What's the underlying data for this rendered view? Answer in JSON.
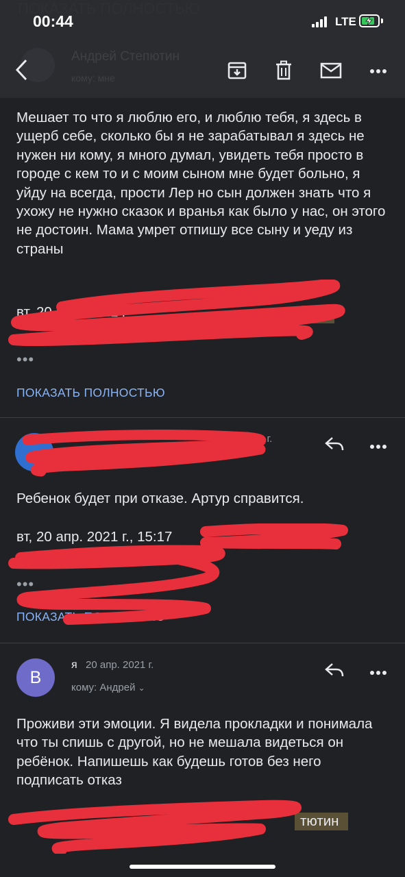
{
  "status_bar": {
    "time": "00:44",
    "network": "LTE"
  },
  "header": {
    "title_faded": "ПОКАЗАТЬ ПОЛНОСТЬЮ",
    "sender_faded": "Андрей Степютин",
    "sub_faded": "кому: мне",
    "icons": [
      "back-icon",
      "archive-icon",
      "delete-icon",
      "mail-icon",
      "more-icon"
    ]
  },
  "messages": [
    {
      "body": "Мешает то что я люблю его, и люблю тебя, я здесь в ущерб себе, сколько бы я не зарабатывал я здесь не нужен ни кому, я много думал, увидеть тебя просто в городе с кем то и с моим сыном мне будет больно, я уйду на всегда, прости Лер но сын должен знать что я ухожу не нужно сказок и вранья как было у нас, он этого не достоин. Мама умрет отпишу все сыну и уеду из страны",
      "quote": "вт, 20 апр. 2021 г.",
      "more": "•••",
      "show_full": "ПОКАЗАТЬ ПОЛНОСТЬЮ"
    },
    {
      "date": "2021 г.",
      "body": "Ребенок будет при отказе. Артур справится.",
      "quote": "вт, 20 апр. 2021 г., 15:17",
      "more": "•••",
      "show_full": "ПОКАЗАТЬ ПОЛНОСТЬЮ"
    },
    {
      "avatar_letter": "В",
      "sender": "я",
      "date": "20 апр. 2021 г.",
      "recipient": "кому: Андрей",
      "body": "Проживи эти эмоции. Я видела прокладки и понимала что ты спишь с другой, но не мешала видеться он ребёнок. Напишешь как будешь готов без него подписать отказ",
      "quote_tail": "тютин"
    }
  ],
  "colors": {
    "background": "#202124",
    "link": "#8ab4f8",
    "scribble": "#e8303c",
    "avatar": "#6e6bc9"
  }
}
